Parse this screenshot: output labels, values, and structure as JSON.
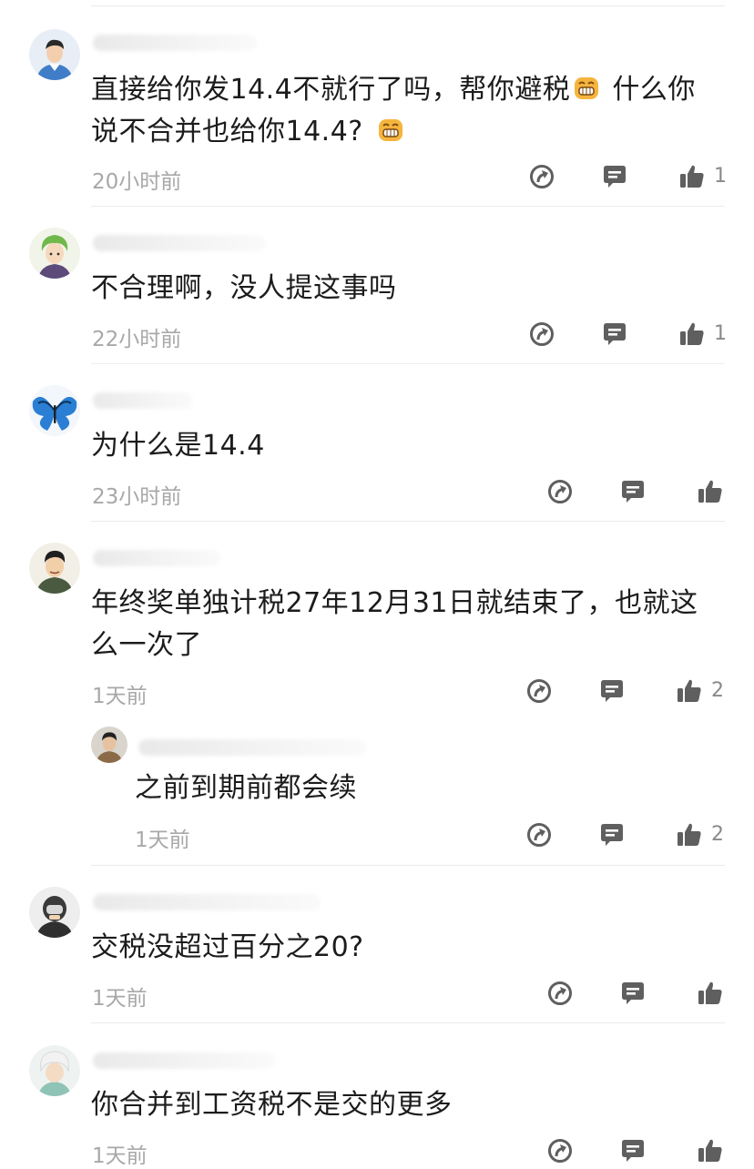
{
  "comments": [
    {
      "text_a": "直接给你发14.4不就行了吗，帮你避税",
      "text_b": " 什么你说不合并也给你14.4?",
      "time": "20小时前",
      "likes": "1",
      "avatar_icon": "man-blue-shirt-avatar"
    },
    {
      "text": "不合理啊，没人提这事吗",
      "time": "22小时前",
      "likes": "1",
      "avatar_icon": "green-hair-avatar"
    },
    {
      "text": "为什么是14.4",
      "time": "23小时前",
      "likes": "",
      "avatar_icon": "blue-butterfly-avatar"
    },
    {
      "text": "年终奖单独计税27年12月31日就结束了，也就这么一次了",
      "time": "1天前",
      "likes": "2",
      "avatar_icon": "cartoon-man-avatar"
    },
    {
      "text": "之前到期前都会续",
      "time": "1天前",
      "likes": "2",
      "avatar_icon": "man-photo-avatar",
      "is_reply": true
    },
    {
      "text": "交税没超过百分之20?",
      "time": "1天前",
      "likes": "",
      "avatar_icon": "helmet-rider-avatar"
    },
    {
      "text": "你合并到工资税不是交的更多",
      "time": "1天前",
      "likes": "",
      "avatar_icon": "white-hair-avatar"
    }
  ],
  "colors": {
    "icon": "#5f5f5f",
    "time": "#a8a8a8",
    "divider": "#ececec",
    "emoji": "#f5b53d"
  }
}
